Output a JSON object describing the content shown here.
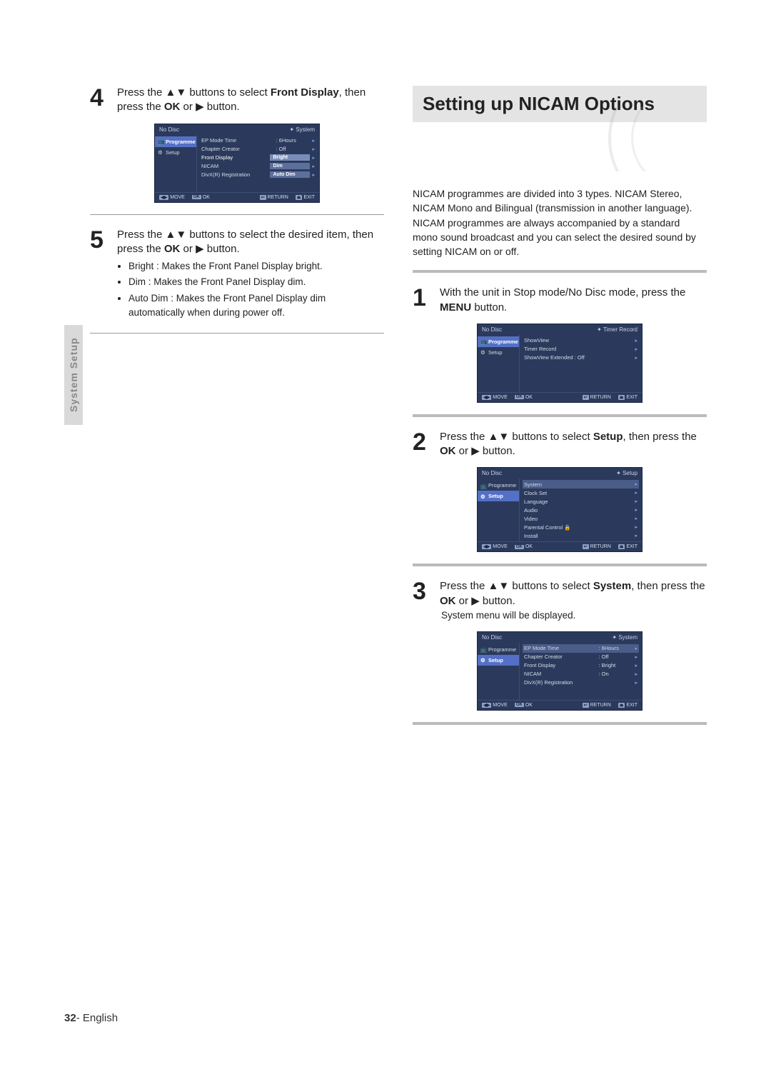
{
  "sideTab": "System Setup",
  "pageFooter": {
    "num": "32",
    "sep": "- ",
    "lang": "English"
  },
  "left": {
    "step4": {
      "num": "4",
      "text_pre": "Press the ",
      "text_mid1": " buttons to select ",
      "bold1": "Front Display",
      "text_mid2": ", then press the ",
      "bold2": "OK",
      "text_mid3": " or ",
      "text_end": " button."
    },
    "osd4": {
      "noDisc": "No Disc",
      "crumb": "✦ System",
      "leftTabs": [
        "Programme",
        "Setup"
      ],
      "rows": [
        {
          "lbl": "EP Mode Time",
          "val": ": 6Hours"
        },
        {
          "lbl": "Chapter Creator",
          "val": ": Off"
        },
        {
          "lbl": "Front Display",
          "val": "Bright",
          "popup": true,
          "sel": true
        },
        {
          "lbl": "NICAM",
          "val": "Dim",
          "popup": true
        },
        {
          "lbl": "DivX(R) Registration",
          "val": "Auto Dim",
          "popup": true
        }
      ],
      "foot": [
        "MOVE",
        "OK",
        "RETURN",
        "EXIT"
      ]
    },
    "step5": {
      "num": "5",
      "text_pre": "Press the ",
      "text_mid1": " buttons to select the desired item, then press the ",
      "bold1": "OK",
      "text_mid2": " or ",
      "text_end": " button.",
      "bullets": [
        "Bright : Makes the Front Panel Display bright.",
        "Dim : Makes the Front Panel Display dim.",
        "Auto Dim : Makes the Front Panel Display dim automatically when during power off."
      ]
    }
  },
  "right": {
    "title": "Setting up NICAM Options",
    "intro": "NICAM programmes are divided into 3 types. NICAM Stereo, NICAM Mono and Bilingual (transmission in another language). NICAM programmes are always accompanied by a standard mono sound broadcast and you can select the desired sound by setting NICAM on or off.",
    "step1": {
      "num": "1",
      "text_pre": "With the unit in Stop mode/No Disc mode, press the ",
      "bold1": "MENU",
      "text_end": " button."
    },
    "osd1": {
      "noDisc": "No Disc",
      "crumb": "✦ Timer Record",
      "leftTabs": [
        "Programme",
        "Setup"
      ],
      "rows": [
        {
          "lbl": "ShowView",
          "val": ""
        },
        {
          "lbl": "Timer Record",
          "val": ""
        },
        {
          "lbl": "ShowView Extended : Off",
          "val": ""
        }
      ],
      "foot": [
        "MOVE",
        "OK",
        "RETURN",
        "EXIT"
      ]
    },
    "step2": {
      "num": "2",
      "text_pre": "Press the ",
      "text_mid1": " buttons to select ",
      "bold1": "Setup",
      "text_mid2": ", then press the ",
      "bold2": "OK",
      "text_mid3": " or ",
      "text_end": " button."
    },
    "osd2": {
      "noDisc": "No Disc",
      "crumb": "✦ Setup",
      "leftTabs": [
        "Programme",
        "Setup"
      ],
      "rows": [
        {
          "lbl": "System",
          "val": "",
          "boxrow": true
        },
        {
          "lbl": "Clock Set",
          "val": ""
        },
        {
          "lbl": "Language",
          "val": ""
        },
        {
          "lbl": "Audio",
          "val": ""
        },
        {
          "lbl": "Video",
          "val": ""
        },
        {
          "lbl": "Parental Control 🔒",
          "val": ""
        },
        {
          "lbl": "Install",
          "val": ""
        }
      ],
      "foot": [
        "MOVE",
        "OK",
        "RETURN",
        "EXIT"
      ]
    },
    "step3": {
      "num": "3",
      "text_pre": "Press the ",
      "text_mid1": " buttons to select ",
      "bold1": "System",
      "text_mid2": ", then press the ",
      "bold2": "OK",
      "text_mid3": " or ",
      "text_end": " button.",
      "sub": "System menu will be displayed."
    },
    "osd3": {
      "noDisc": "No Disc",
      "crumb": "✦ System",
      "leftTabs": [
        "Programme",
        "Setup"
      ],
      "rows": [
        {
          "lbl": "EP Mode Time",
          "val": ": 6Hours",
          "boxrow": true
        },
        {
          "lbl": "Chapter Creator",
          "val": ": Off"
        },
        {
          "lbl": "Front Display",
          "val": ": Bright"
        },
        {
          "lbl": "NICAM",
          "val": ": On"
        },
        {
          "lbl": "DivX(R) Registration",
          "val": ""
        }
      ],
      "foot": [
        "MOVE",
        "OK",
        "RETURN",
        "EXIT"
      ]
    }
  }
}
